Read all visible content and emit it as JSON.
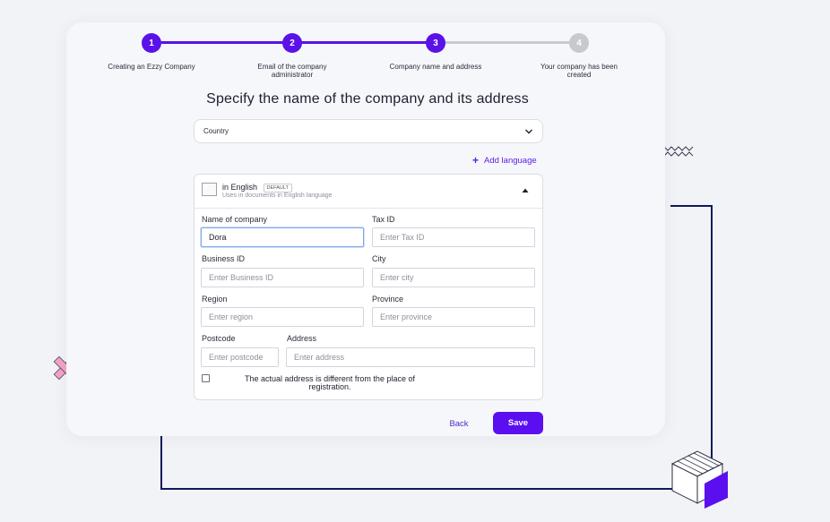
{
  "stepper": {
    "steps": [
      {
        "number": "1",
        "label": "Creating an Ezzy Company",
        "state": "done"
      },
      {
        "number": "2",
        "label": "Email of the company administrator",
        "state": "done"
      },
      {
        "number": "3",
        "label": "Company name and address",
        "state": "active"
      },
      {
        "number": "4",
        "label": "Your company has been created",
        "state": "pending"
      }
    ]
  },
  "heading": "Specify the name of the company and its address",
  "country": {
    "label": "Country",
    "icon": "chevron-down-icon"
  },
  "add_language": {
    "label": "Add language",
    "icon": "plus-icon"
  },
  "language_panel": {
    "name": "in English",
    "badge": "DEFAULT",
    "subtitle": "Uses in documents in English language",
    "icon": "caret-up-icon"
  },
  "form": {
    "name_of_company": {
      "label": "Name of company",
      "value": "Dora",
      "placeholder": ""
    },
    "tax_id": {
      "label": "Tax ID",
      "value": "",
      "placeholder": "Enter Tax ID"
    },
    "business_id": {
      "label": "Business ID",
      "value": "",
      "placeholder": "Enter Business ID"
    },
    "city": {
      "label": "City",
      "value": "",
      "placeholder": "Enter city"
    },
    "region": {
      "label": "Region",
      "value": "",
      "placeholder": "Enter region"
    },
    "province": {
      "label": "Province",
      "value": "",
      "placeholder": "Enter province"
    },
    "postcode": {
      "label": "Postcode",
      "value": "",
      "placeholder": "Enter postcode"
    },
    "address": {
      "label": "Address",
      "value": "",
      "placeholder": "Enter address"
    },
    "different_address_checkbox": {
      "label": "The actual address is different from the place of registration.",
      "checked": false
    }
  },
  "actions": {
    "back": "Back",
    "save": "Save"
  },
  "colors": {
    "accent": "#5b0ff0",
    "step_done": "#5a12e8",
    "step_pending": "#c8c9ce",
    "deco_line": "#0e1a5c"
  }
}
